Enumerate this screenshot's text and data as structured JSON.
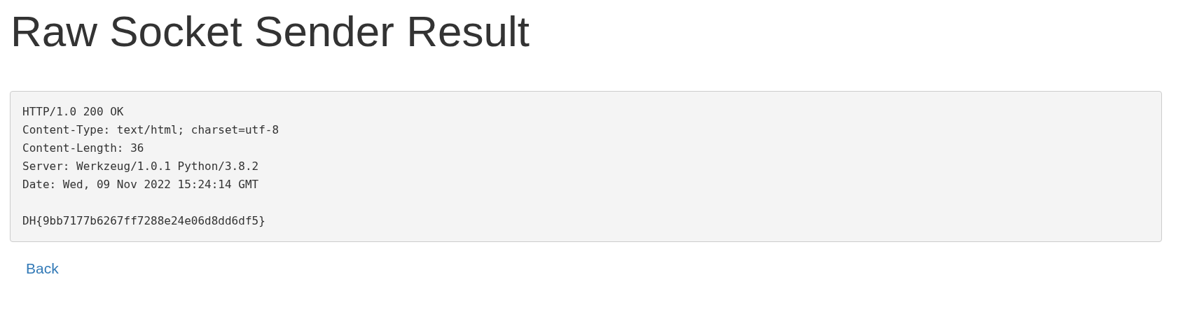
{
  "title": "Raw Socket Sender Result",
  "response": {
    "headers": [
      "HTTP/1.0 200 OK",
      "Content-Type: text/html; charset=utf-8",
      "Content-Length: 36",
      "Server: Werkzeug/1.0.1 Python/3.8.2",
      "Date: Wed, 09 Nov 2022 15:24:14 GMT"
    ],
    "body": "DH{9bb7177b6267ff7288e24e06d8dd6df5}"
  },
  "back_link": "Back"
}
